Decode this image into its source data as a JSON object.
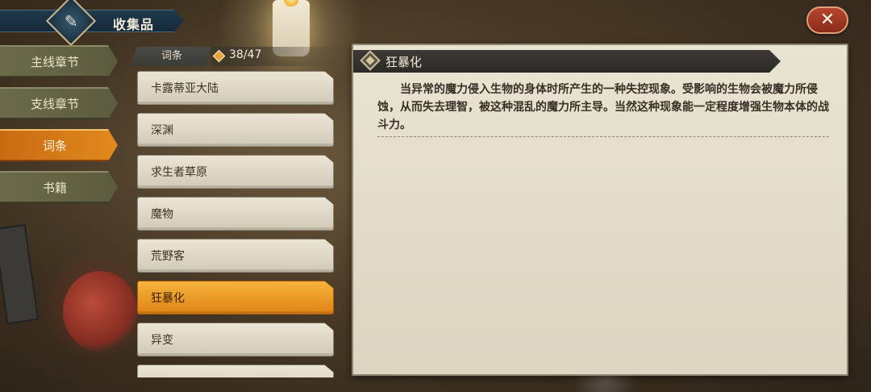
{
  "header": {
    "title": "收集品",
    "emblem_icon": "quill-icon"
  },
  "close": {
    "label": "✕"
  },
  "categories": [
    {
      "label": "主线章节",
      "active": false
    },
    {
      "label": "支线章节",
      "active": false
    },
    {
      "label": "词条",
      "active": true
    },
    {
      "label": "书籍",
      "active": false
    }
  ],
  "list_header": {
    "label": "词条",
    "count": "38/47"
  },
  "entries": [
    {
      "label": "卡露蒂亚大陆",
      "active": false
    },
    {
      "label": "深渊",
      "active": false
    },
    {
      "label": "求生者草原",
      "active": false
    },
    {
      "label": "魔物",
      "active": false
    },
    {
      "label": "荒野客",
      "active": false
    },
    {
      "label": "狂暴化",
      "active": true
    },
    {
      "label": "异变",
      "active": false
    },
    {
      "label": "",
      "active": false
    }
  ],
  "detail": {
    "title": "狂暴化",
    "text": "当异常的魔力侵入生物的身体时所产生的一种失控现象。受影响的生物会被魔力所侵蚀，从而失去理智，被这种混乱的魔力所主导。当然这种现象能一定程度增强生物本体的战斗力。"
  }
}
